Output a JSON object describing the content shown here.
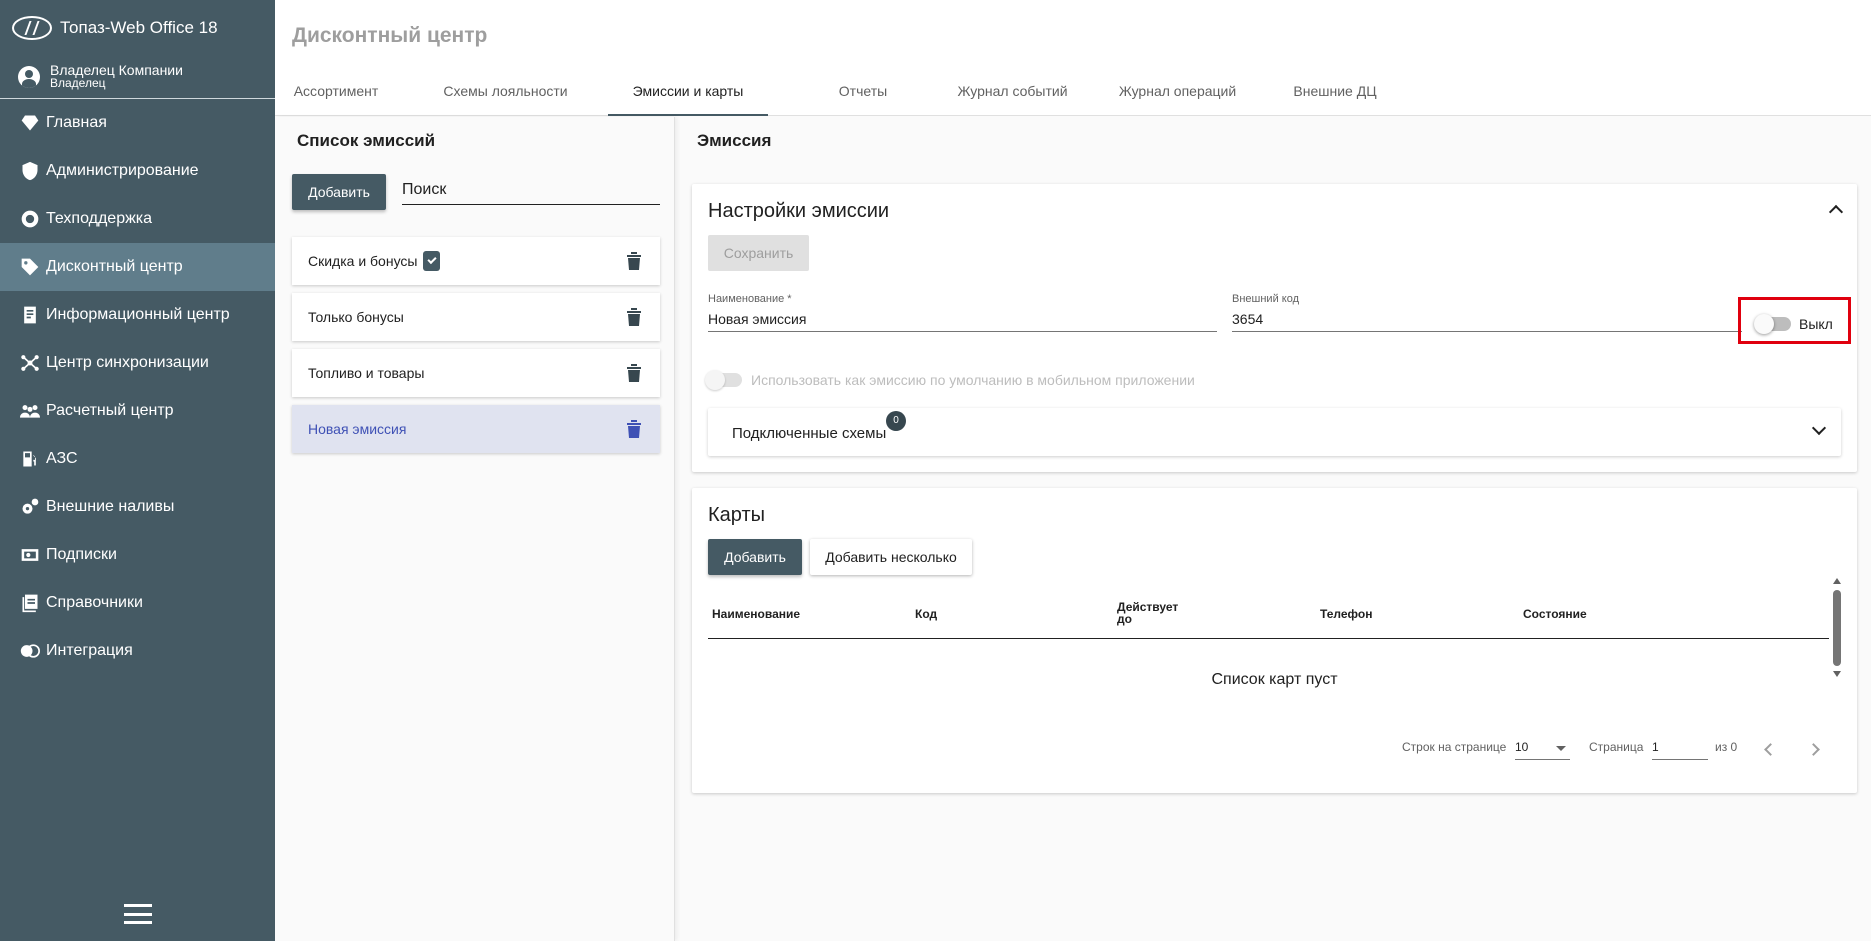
{
  "app": {
    "title": "Топаз-Web Office 18"
  },
  "user": {
    "name": "Владелец Компании",
    "role": "Владелец"
  },
  "sidebar": {
    "items": [
      {
        "label": "Главная",
        "icon": "diamond-icon"
      },
      {
        "label": "Администрирование",
        "icon": "admin-shield-icon"
      },
      {
        "label": "Техподдержка",
        "icon": "lifebuoy-icon"
      },
      {
        "label": "Дисконтный центр",
        "icon": "tag-icon"
      },
      {
        "label": "Информационный центр",
        "icon": "document-icon"
      },
      {
        "label": "Центр синхронизации",
        "icon": "network-icon"
      },
      {
        "label": "Расчетный центр",
        "icon": "people-icon"
      },
      {
        "label": "АЗС",
        "icon": "fuel-pump-icon"
      },
      {
        "label": "Внешние наливы",
        "icon": "gears-icon"
      },
      {
        "label": "Подписки",
        "icon": "subscription-icon"
      },
      {
        "label": "Справочники",
        "icon": "book-icon"
      },
      {
        "label": "Интеграция",
        "icon": "integration-icon"
      }
    ],
    "active_index": 3
  },
  "header": {
    "title": "Дисконтный центр",
    "tabs": [
      "Ассортимент",
      "Схемы лояльности",
      "Эмиссии и карты",
      "Отчеты",
      "Журнал событий",
      "Журнал операций",
      "Внешние ДЦ"
    ],
    "active_tab": 2
  },
  "emission_list": {
    "title": "Список эмиссий",
    "add_label": "Добавить",
    "search_placeholder": "Поиск",
    "items": [
      {
        "label": "Скидка и бонусы",
        "has_badge": true
      },
      {
        "label": "Только бонусы"
      },
      {
        "label": "Топливо и товары"
      },
      {
        "label": "Новая эмиссия",
        "selected": true
      }
    ]
  },
  "emission": {
    "title": "Эмиссия",
    "settings": {
      "title": "Настройки эмиссии",
      "save_label": "Сохранить",
      "name_label": "Наименование *",
      "name_value": "Новая эмиссия",
      "code_label": "Внешний код",
      "code_value": "3654",
      "toggle_label": "Выкл",
      "default_label": "Использовать как эмиссию по умолчанию в мобильном приложении",
      "schemes_label": "Подключенные схемы",
      "schemes_count": "0"
    }
  },
  "cards": {
    "title": "Карты",
    "add_label": "Добавить",
    "add_many_label": "Добавить несколько",
    "columns": [
      "Наименование",
      "Код",
      "Действует до",
      "Телефон",
      "Состояние"
    ],
    "empty_text": "Список карт пуст",
    "pager": {
      "rows_label": "Строк на странице",
      "rows_value": "10",
      "page_label": "Страница",
      "page_value": "1",
      "of_label": "из 0"
    }
  }
}
